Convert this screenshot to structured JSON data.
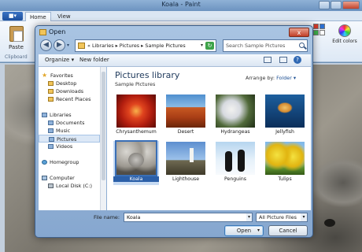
{
  "paint": {
    "title": "Koala - Paint",
    "tabs": [
      "Home",
      "View"
    ],
    "paste_label": "Paste",
    "clipboard_label": "Clipboard",
    "edit_colors_label": "Edit colors",
    "palette_colors": [
      "#d23a2a",
      "#2b6fd1",
      "#3db04b",
      "#ffffff"
    ]
  },
  "dialog": {
    "title": "Open",
    "close_glyph": "x",
    "address": {
      "crumbs": "« Libraries ▸ Pictures ▸ Sample Pictures",
      "dropdown_glyph": "▾",
      "refresh_glyph": "↻"
    },
    "search_placeholder": "Search Sample Pictures",
    "nav_buttons": {
      "back": "◀",
      "forward": "▶",
      "history": "▾"
    },
    "toolbar": {
      "organize": "Organize ▾",
      "new_folder": "New folder",
      "help": "?"
    },
    "nav_pane": [
      {
        "label": "Favorites",
        "icon": "star-icon",
        "indent": 0
      },
      {
        "label": "Desktop",
        "icon": "folder-icon",
        "indent": 1
      },
      {
        "label": "Downloads",
        "icon": "folder-icon",
        "indent": 1
      },
      {
        "label": "Recent Places",
        "icon": "folder-icon",
        "indent": 1
      },
      {
        "label": "Libraries",
        "icon": "library-icon",
        "indent": 0
      },
      {
        "label": "Documents",
        "icon": "library-icon",
        "indent": 1
      },
      {
        "label": "Music",
        "icon": "library-icon",
        "indent": 1
      },
      {
        "label": "Pictures",
        "icon": "library-icon",
        "indent": 1,
        "selected": true
      },
      {
        "label": "Videos",
        "icon": "library-icon",
        "indent": 1
      },
      {
        "label": "Homegroup",
        "icon": "homegroup-icon",
        "indent": 0
      },
      {
        "label": "Computer",
        "icon": "computer-icon",
        "indent": 0
      },
      {
        "label": "Local Disk (C:)",
        "icon": "disk-icon",
        "indent": 1
      }
    ],
    "library": {
      "title": "Pictures library",
      "subtitle": "Sample Pictures",
      "arrange_label": "Arrange by:",
      "arrange_value": "Folder ▾"
    },
    "files": [
      {
        "name": "Chrysanthemum",
        "thumb": "chrysanthemum"
      },
      {
        "name": "Desert",
        "thumb": "desert"
      },
      {
        "name": "Hydrangeas",
        "thumb": "hydrangeas"
      },
      {
        "name": "Jellyfish",
        "thumb": "jellyfish"
      },
      {
        "name": "Koala",
        "thumb": "koala",
        "selected": true
      },
      {
        "name": "Lighthouse",
        "thumb": "lighthouse"
      },
      {
        "name": "Penguins",
        "thumb": "penguins"
      },
      {
        "name": "Tulips",
        "thumb": "tulips"
      }
    ],
    "file_name_label": "File name:",
    "file_name_value": "Koala",
    "filter_value": "All Picture Files",
    "dropdown_glyph": "▾",
    "open_button": "Open",
    "cancel_button": "Cancel"
  }
}
